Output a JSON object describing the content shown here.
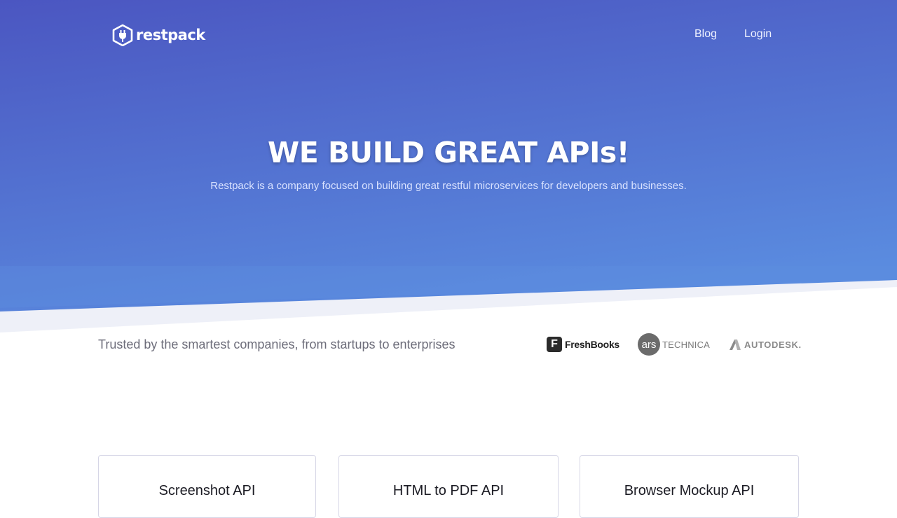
{
  "nav": {
    "logo_text": "restpack",
    "links": [
      "Blog",
      "Login"
    ]
  },
  "hero": {
    "title": "WE BUILD GREAT APIs!",
    "subtitle": "Restpack is a company focused on building great restful microservices for developers and businesses."
  },
  "trusted": {
    "text": "Trusted by the smartest companies, from startups to enterprises",
    "brands": {
      "freshbooks": {
        "icon_letter": "F",
        "name": "FreshBooks"
      },
      "ars": {
        "circle_text": "ars",
        "name": "TECHNICA"
      },
      "autodesk": {
        "name": "AUTODESK."
      }
    }
  },
  "products": [
    {
      "title": "Screenshot API"
    },
    {
      "title": "HTML to PDF API"
    },
    {
      "title": "Browser Mockup API"
    }
  ],
  "colors": {
    "hero_top": "#4a5cc4",
    "hero_bottom": "#5b86dd",
    "wave_light": "#eef0f8"
  }
}
